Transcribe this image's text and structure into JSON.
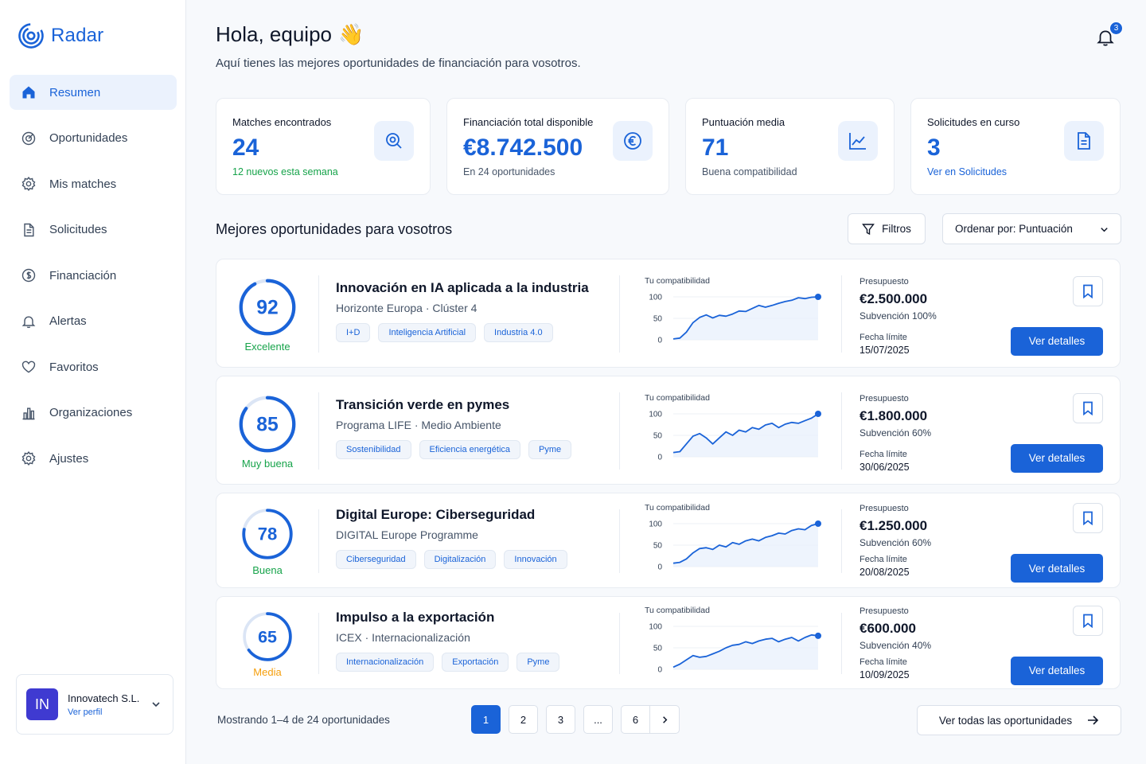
{
  "app": {
    "name": "Radar",
    "accent": "#1a63d8"
  },
  "sidebar": {
    "items": [
      {
        "label": "Resumen",
        "icon": "home-icon",
        "active": true
      },
      {
        "label": "Oportunidades",
        "icon": "target-icon"
      },
      {
        "label": "Mis matches",
        "icon": "gear-icon"
      },
      {
        "label": "Solicitudes",
        "icon": "document-icon"
      },
      {
        "label": "Financiación",
        "icon": "dollar-icon"
      },
      {
        "label": "Alertas",
        "icon": "bell-icon"
      },
      {
        "label": "Favoritos",
        "icon": "heart-icon"
      },
      {
        "label": "Organizaciones",
        "icon": "bar-chart-icon"
      },
      {
        "label": "Ajustes",
        "icon": "settings-icon"
      }
    ],
    "profile": {
      "initials": "IN",
      "name": "Innovatech S.L.",
      "link": "Ver perfil"
    }
  },
  "header": {
    "greeting": "Hola, equipo",
    "emoji": "👋",
    "subtitle": "Aquí tienes las mejores oportunidades de financiación para vosotros.",
    "notifications": "3"
  },
  "stats": [
    {
      "label": "Matches encontrados",
      "value": "24",
      "note": "12 nuevos esta semana",
      "icon": "search-match-icon"
    },
    {
      "label": "Financiación total disponible",
      "value": "€8.742.500",
      "note": "En 24 oportunidades",
      "icon": "euro-icon"
    },
    {
      "label": "Puntuación media",
      "value": "71",
      "note": "Buena compatibilidad",
      "icon": "trend-chart-icon"
    },
    {
      "label": "Solicitudes en curso",
      "value": "3",
      "note": "Ver en Solicitudes",
      "icon": "document-icon"
    }
  ],
  "section": {
    "title": "Mejores oportunidades para vosotros",
    "filters_label": "Filtros",
    "sort_label": "Ordenar por: Puntuación"
  },
  "opportunities": [
    {
      "score": "92",
      "score_value": 92,
      "score_label": "Excelente",
      "score_color": "#16a34a",
      "title": "Innovación en IA aplicada a la industria",
      "subtitle": "Horizonte Europa · Clúster 4",
      "tags": [
        "I+D",
        "Inteligencia Artificial",
        "Industria 4.0"
      ],
      "chart_caption": "Tu compatibilidad",
      "y_ticks": [
        "100",
        "50",
        "0"
      ],
      "series": [
        2,
        4,
        18,
        40,
        52,
        58,
        51,
        57,
        55,
        60,
        67,
        66,
        73,
        80,
        76,
        80,
        85,
        89,
        92,
        98,
        96,
        99,
        100
      ],
      "budget_label": "Presupuesto",
      "budget": "€2.500.000",
      "subsidy": "Subvención 100%",
      "deadline_label": "Fecha límite",
      "deadline": "15/07/2025",
      "cta": "Ver detalles"
    },
    {
      "score": "85",
      "score_value": 85,
      "score_label": "Muy buena",
      "score_color": "#16a34a",
      "title": "Transición verde en pymes",
      "subtitle": "Programa LIFE · Medio Ambiente",
      "tags": [
        "Sostenibilidad",
        "Eficiencia energética",
        "Pyme"
      ],
      "chart_caption": "Tu compatibilidad",
      "y_ticks": [
        "100",
        "50",
        "0"
      ],
      "series": [
        10,
        12,
        30,
        48,
        54,
        44,
        30,
        44,
        58,
        50,
        62,
        58,
        68,
        64,
        74,
        78,
        68,
        76,
        80,
        78,
        84,
        90,
        100
      ],
      "budget_label": "Presupuesto",
      "budget": "€1.800.000",
      "subsidy": "Subvención 60%",
      "deadline_label": "Fecha límite",
      "deadline": "30/06/2025",
      "cta": "Ver detalles"
    },
    {
      "score": "78",
      "score_value": 78,
      "score_label": "Buena",
      "score_color": "#16a34a",
      "title": "Digital Europe: Ciberseguridad",
      "subtitle": "DIGITAL Europe Programme",
      "tags": [
        "Ciberseguridad",
        "Digitalización",
        "Innovación"
      ],
      "chart_caption": "Tu compatibilidad",
      "y_ticks": [
        "100",
        "50",
        "0"
      ],
      "series": [
        8,
        10,
        18,
        32,
        42,
        44,
        40,
        50,
        46,
        56,
        52,
        60,
        64,
        60,
        68,
        72,
        78,
        76,
        84,
        88,
        86,
        96,
        100
      ],
      "budget_label": "Presupuesto",
      "budget": "€1.250.000",
      "subsidy": "Subvención 60%",
      "deadline_label": "Fecha límite",
      "deadline": "20/08/2025",
      "cta": "Ver detalles"
    },
    {
      "score": "65",
      "score_value": 65,
      "score_label": "Media",
      "score_color": "#f59e0b",
      "title": "Impulso a la exportación",
      "subtitle": "ICEX · Internacionalización",
      "tags": [
        "Internacionalización",
        "Exportación",
        "Pyme"
      ],
      "chart_caption": "Tu compatibilidad",
      "y_ticks": [
        "100",
        "50",
        "0"
      ],
      "series": [
        5,
        12,
        22,
        32,
        28,
        30,
        36,
        42,
        50,
        56,
        58,
        64,
        60,
        66,
        70,
        72,
        64,
        70,
        74,
        66,
        74,
        80,
        78
      ],
      "budget_label": "Presupuesto",
      "budget": "€600.000",
      "subsidy": "Subvención 40%",
      "deadline_label": "Fecha límite",
      "deadline": "10/09/2025",
      "cta": "Ver detalles"
    }
  ],
  "footer": {
    "showing": "Mostrando 1–4 de 24 oportunidades",
    "pages": [
      "1",
      "2",
      "3",
      "...",
      "6"
    ],
    "current_page": "1",
    "view_all": "Ver todas las oportunidades"
  }
}
